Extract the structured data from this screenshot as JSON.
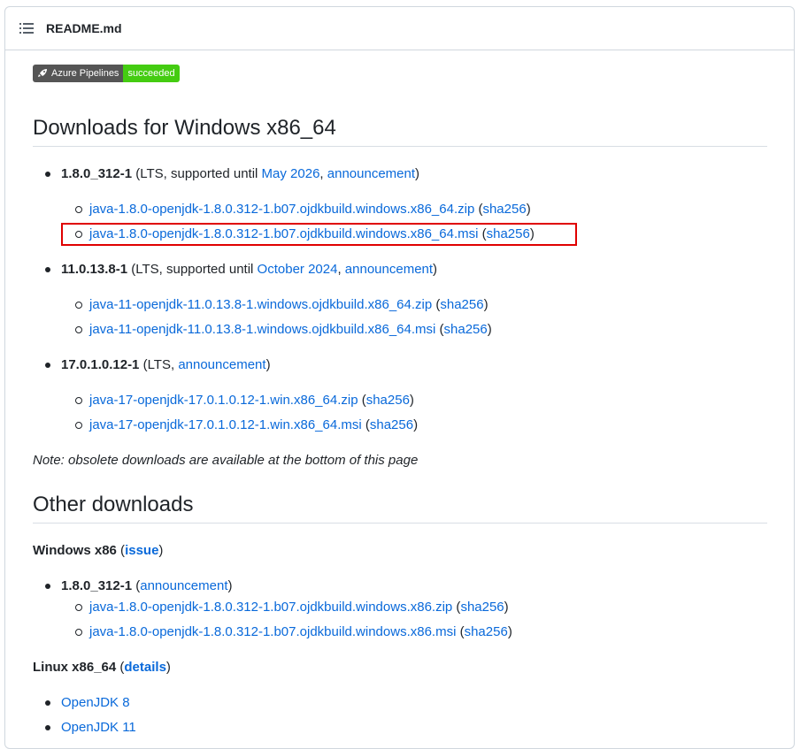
{
  "header": {
    "filename": "README.md"
  },
  "badge": {
    "left": "Azure Pipelines",
    "right": "succeeded"
  },
  "section1": {
    "title": "Downloads for Windows x86_64",
    "releases": [
      {
        "version": "1.8.0_312-1",
        "meta_pre": " (LTS, supported until ",
        "until_link": "May 2026",
        "sep": ", ",
        "announce_link": "announcement",
        "meta_post": ")",
        "files": [
          {
            "name": "java-1.8.0-openjdk-1.8.0.312-1.b07.ojdkbuild.windows.x86_64.zip",
            "sha": "sha256"
          },
          {
            "name": "java-1.8.0-openjdk-1.8.0.312-1.b07.ojdkbuild.windows.x86_64.msi",
            "sha": "sha256"
          }
        ]
      },
      {
        "version": "11.0.13.8-1",
        "meta_pre": " (LTS, supported until ",
        "until_link": "October 2024",
        "sep": ", ",
        "announce_link": "announcement",
        "meta_post": ")",
        "files": [
          {
            "name": "java-11-openjdk-11.0.13.8-1.windows.ojdkbuild.x86_64.zip",
            "sha": "sha256"
          },
          {
            "name": "java-11-openjdk-11.0.13.8-1.windows.ojdkbuild.x86_64.msi",
            "sha": "sha256"
          }
        ]
      },
      {
        "version": "17.0.1.0.12-1",
        "meta_pre": " (LTS, ",
        "announce_link": "announcement",
        "meta_post": ")",
        "files": [
          {
            "name": "java-17-openjdk-17.0.1.0.12-1.win.x86_64.zip",
            "sha": "sha256"
          },
          {
            "name": "java-17-openjdk-17.0.1.0.12-1.win.x86_64.msi",
            "sha": "sha256"
          }
        ]
      }
    ],
    "note": "Note: obsolete downloads are available at the bottom of this page"
  },
  "section2": {
    "title": "Other downloads",
    "win32": {
      "label": "Windows x86",
      "paren_open": " (",
      "link": "issue",
      "paren_close": ")",
      "release": {
        "version": "1.8.0_312-1",
        "meta_pre": " (",
        "announce_link": "announcement",
        "meta_post": ")",
        "files": [
          {
            "name": "java-1.8.0-openjdk-1.8.0.312-1.b07.ojdkbuild.windows.x86.zip",
            "sha": "sha256"
          },
          {
            "name": "java-1.8.0-openjdk-1.8.0.312-1.b07.ojdkbuild.windows.x86.msi",
            "sha": "sha256"
          }
        ]
      }
    },
    "linux": {
      "label": "Linux x86_64",
      "paren_open": " (",
      "link": "details",
      "paren_close": ")",
      "items": [
        "OpenJDK 8",
        "OpenJDK 11"
      ]
    }
  },
  "colors": {
    "link": "#0969da",
    "highlight": "#e00000",
    "badge_ok": "#4c1"
  },
  "sha_paren_open": " (",
  "sha_paren_close": ")"
}
